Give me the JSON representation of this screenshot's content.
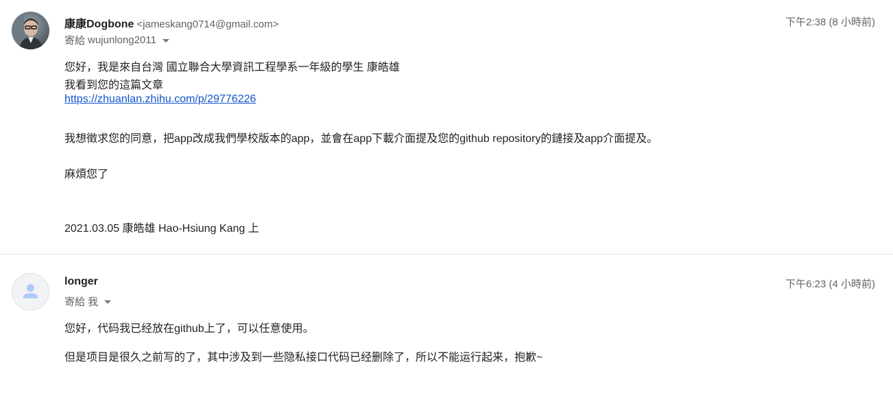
{
  "messages": [
    {
      "sender_name": "康康Dogbone",
      "sender_email": "<jameskang0714@gmail.com>",
      "to_label": "寄給",
      "to_value": "wujunlong2011",
      "timestamp": "下午2:38 (8 小時前)",
      "avatar": "user-photo",
      "body": {
        "line1": "您好，我是來自台灣 國立聯合大學資訊工程學系一年級的學生 康皓雄",
        "line2": "我看到您的這篇文章",
        "link": "https://zhuanlan.zhihu.com/p/29776226",
        "line3": "我想徵求您的同意，把app改成我們學校版本的app，並會在app下載介面提及您的github repository的鏈接及app介面提及。",
        "line4": "麻煩您了",
        "signature": "2021.03.05 康皓雄 Hao-Hsiung Kang 上"
      }
    },
    {
      "sender_name": "longer",
      "to_label": "寄給",
      "to_value": "我",
      "timestamp": "下午6:23 (4 小時前)",
      "avatar": "default-person-icon",
      "body": {
        "line1": "您好，代码我已经放在github上了，可以任意使用。",
        "line2": "但是项目是很久之前写的了，其中涉及到一些隐私接口代码已经删除了，所以不能运行起来，抱歉~"
      }
    }
  ],
  "colors": {
    "link": "#1155cc",
    "meta": "#5f6368",
    "text": "#222222",
    "divider": "#e5e5e5"
  }
}
